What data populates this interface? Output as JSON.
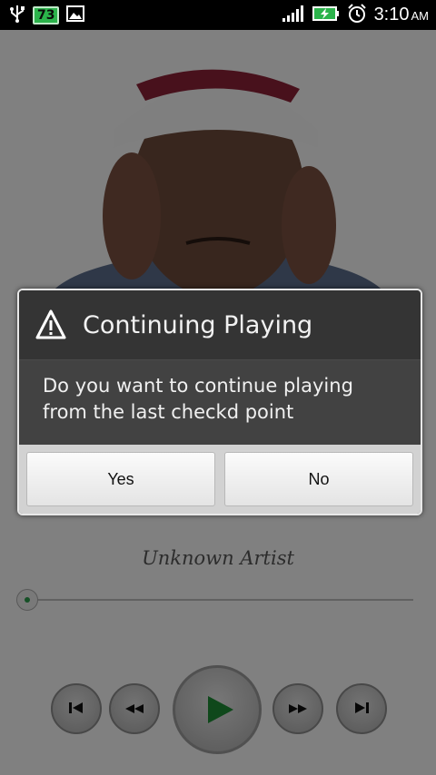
{
  "status_bar": {
    "notification_badge": "73",
    "time": "3:10",
    "ampm": "AM",
    "icons": [
      "usb-icon",
      "image-icon",
      "signal-icon",
      "battery-charging-icon",
      "alarm-icon"
    ]
  },
  "player": {
    "artist": "Unknown Artist",
    "controls": [
      "skip-previous",
      "rewind",
      "play",
      "fast-forward",
      "skip-next"
    ],
    "accent_color": "#1e8a35"
  },
  "dialog": {
    "title": "Continuing Playing",
    "message": "Do you want to continue playing from the last checkd point",
    "yes_label": "Yes",
    "no_label": "No"
  }
}
